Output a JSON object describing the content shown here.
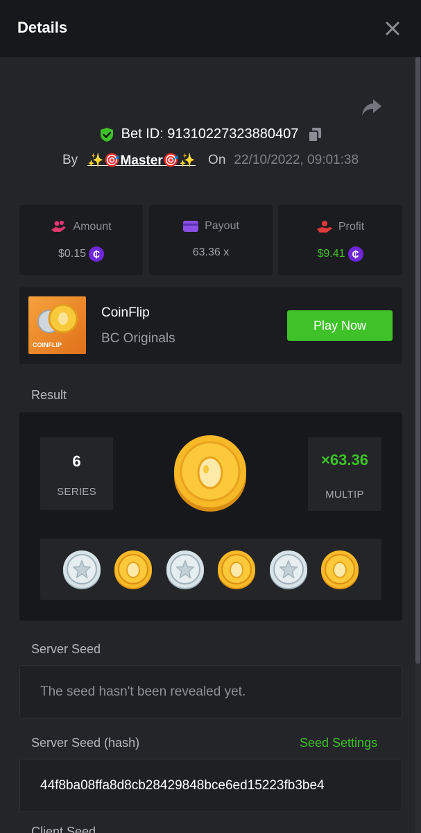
{
  "header": {
    "title": "Details",
    "close_icon": "close-icon"
  },
  "bet": {
    "bet_id_text": "Bet ID: 91310227323880407",
    "by_label": "By",
    "username": "✨🎯Master🎯✨",
    "on_label": "On",
    "datetime": "22/10/2022, 09:01:38"
  },
  "stats": {
    "amount": {
      "label": "Amount",
      "value": "$0.15",
      "icon": "coins-hand-icon",
      "currency": "₵"
    },
    "payout": {
      "label": "Payout",
      "value": "63.36 x",
      "icon": "card-icon"
    },
    "profit": {
      "label": "Profit",
      "value": "$9.41",
      "icon": "hand-coin-icon",
      "currency": "₵"
    }
  },
  "game": {
    "name": "CoinFlip",
    "provider": "BC Originals",
    "thumb_label": "COINFLIP",
    "play_label": "Play Now"
  },
  "result": {
    "label": "Result",
    "series_value": "6",
    "series_label": "SERIES",
    "multiplier_value": "×63.36",
    "multiplier_label": "MULTIP",
    "history": [
      "silver",
      "gold",
      "silver",
      "gold",
      "silver",
      "gold"
    ]
  },
  "server_seed": {
    "label": "Server Seed",
    "value": "The seed hasn't been revealed yet."
  },
  "server_seed_hash": {
    "label": "Server Seed (hash)",
    "settings_link": "Seed Settings",
    "value": "44f8ba08ffa8d8cb28429848bce6ed15223fb3be4"
  },
  "client_seed": {
    "label": "Client Seed"
  },
  "colors": {
    "accent_green": "#3fc229",
    "currency_purple": "#6f27d9",
    "amount_pink": "#e8366e",
    "payout_purple": "#8b4fe8",
    "profit_red": "#e23a3a"
  }
}
